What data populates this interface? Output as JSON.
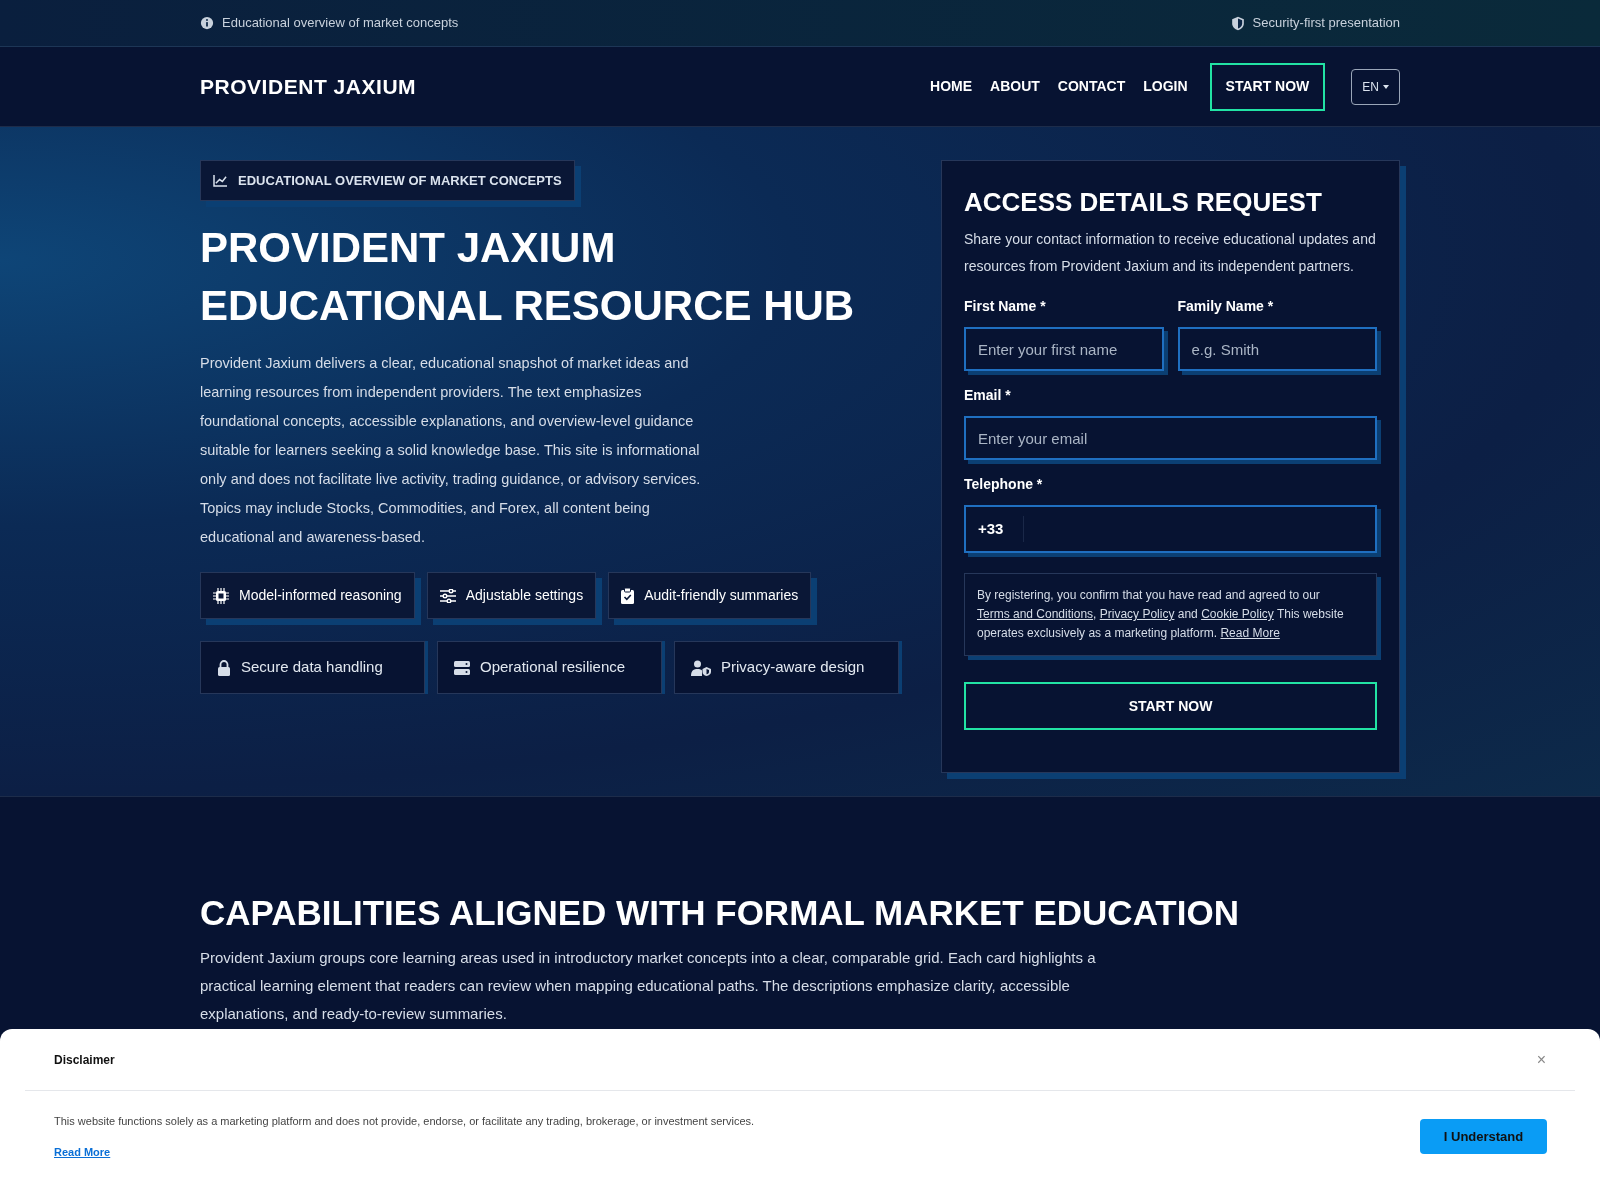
{
  "top_bar": {
    "left": "Educational overview of market concepts",
    "right": "Security-first presentation"
  },
  "nav": {
    "logo": "PROVIDENT JAXIUM",
    "links": [
      "HOME",
      "ABOUT",
      "CONTACT",
      "LOGIN"
    ],
    "cta": "START NOW",
    "language": "EN"
  },
  "hero": {
    "badge": "EDUCATIONAL OVERVIEW OF MARKET CONCEPTS",
    "title": "PROVIDENT JAXIUM EDUCATIONAL RESOURCE HUB",
    "text": "Provident Jaxium delivers a clear, educational snapshot of market ideas and learning resources from independent providers. The text emphasizes foundational concepts, accessible explanations, and overview-level guidance suitable for learners seeking a solid knowledge base. This site is informational only and does not facilitate live activity, trading guidance, or advisory services. Topics may include Stocks, Commodities, and Forex, all content being educational and awareness-based.",
    "chips": [
      {
        "kind": "chip",
        "label": "Model-informed reasoning"
      },
      {
        "kind": "chip",
        "label": "Adjustable settings"
      },
      {
        "kind": "chip",
        "label": "Audit-friendly summaries"
      }
    ],
    "features": [
      {
        "kind": "feature",
        "label": "Secure data handling"
      },
      {
        "kind": "feature",
        "label": "Operational resilience"
      },
      {
        "kind": "feature",
        "label": "Privacy-aware design"
      }
    ]
  },
  "form": {
    "title": "ACCESS DETAILS REQUEST",
    "intro": "Share your contact information to receive educational updates and resources from Provident Jaxium and its independent partners.",
    "first_name": {
      "label": "First Name *",
      "placeholder": "Enter your first name"
    },
    "family_name": {
      "label": "Family Name *",
      "placeholder": "e.g. Smith"
    },
    "email": {
      "label": "Email *",
      "placeholder": "Enter your email"
    },
    "telephone": {
      "label": "Telephone *",
      "prefix": "+33"
    },
    "consent": {
      "before": "By registering, you confirm that you have read and agreed to our",
      "terms": "Terms and Conditions",
      "comma": ",",
      "privacy": "Privacy Policy",
      "and": "and",
      "cookie": "Cookie Policy",
      "after": "This website operates exclusively as a marketing platform.",
      "read_more": "Read More"
    },
    "submit": "START NOW"
  },
  "capabilities": {
    "title": "CAPABILITIES ALIGNED WITH FORMAL MARKET EDUCATION",
    "text": "Provident Jaxium groups core learning areas used in introductory market concepts into a clear, comparable grid. Each card highlights a practical learning element that readers can review when mapping educational paths. The descriptions emphasize clarity, accessible explanations, and ready-to-review summaries."
  },
  "disclaimer": {
    "title": "Disclaimer",
    "close": "×",
    "text": "This website functions solely as a marketing platform and does not provide, endorse, or facilitate any trading, brokerage, or investment services.",
    "read_more": "Read More",
    "button": "I Understand"
  }
}
